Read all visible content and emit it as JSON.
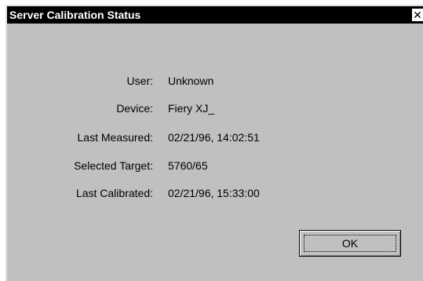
{
  "window": {
    "title": "Server Calibration Status",
    "close_glyph": "✕"
  },
  "fields": [
    {
      "label": "User:",
      "value": "Unknown"
    },
    {
      "label": "Device:",
      "value": "Fiery XJ_"
    },
    {
      "label": "Last Measured:",
      "value": "02/21/96, 14:02:51"
    },
    {
      "label": "Selected Target:",
      "value": "5760/65"
    },
    {
      "label": "Last Calibrated:",
      "value": "02/21/96, 15:33:00"
    }
  ],
  "buttons": {
    "ok_label": "OK"
  }
}
